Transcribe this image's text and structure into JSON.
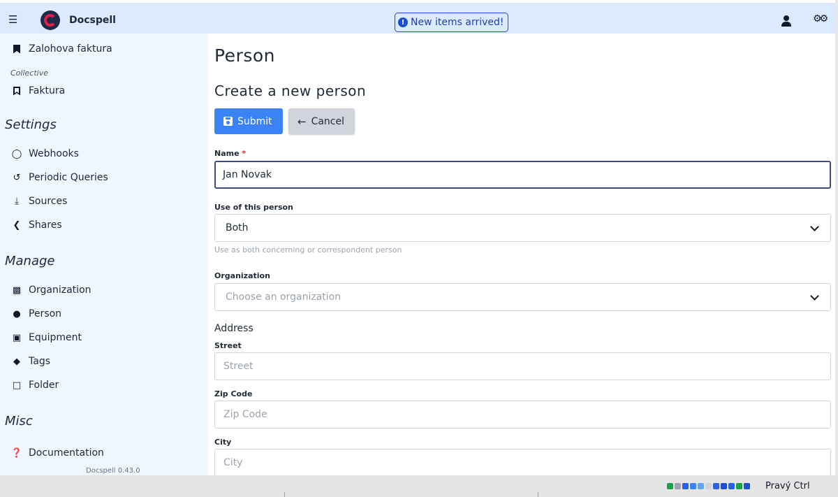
{
  "header": {
    "app_name": "Docspell",
    "banner": "New items arrived!",
    "banner_icon": "info-circle-icon",
    "brand_color": "#1e2a4a"
  },
  "sidebar": {
    "bookmarks": [
      {
        "label": "Zalohova faktura",
        "icon": "bookmark-solid-icon"
      }
    ],
    "collective_label": "Collective",
    "collective_bookmarks": [
      {
        "label": "Faktura",
        "icon": "bookmark-outline-icon"
      }
    ],
    "settings_heading": "Settings",
    "settings": [
      {
        "label": "Webhooks",
        "icon": "comment-icon"
      },
      {
        "label": "Periodic Queries",
        "icon": "history-icon"
      },
      {
        "label": "Sources",
        "icon": "upload-icon"
      },
      {
        "label": "Shares",
        "icon": "share-icon"
      }
    ],
    "manage_heading": "Manage",
    "manage": [
      {
        "label": "Organization",
        "icon": "industry-icon"
      },
      {
        "label": "Person",
        "icon": "user-icon"
      },
      {
        "label": "Equipment",
        "icon": "box-icon"
      },
      {
        "label": "Tags",
        "icon": "tags-icon"
      },
      {
        "label": "Folder",
        "icon": "folder-icon"
      }
    ],
    "misc_heading": "Misc",
    "misc": [
      {
        "label": "Documentation",
        "icon": "question-circle-icon"
      }
    ],
    "version": "Docspell 0.43.0"
  },
  "main": {
    "title": "Person",
    "subtitle": "Create a new person",
    "submit_label": "Submit",
    "cancel_label": "Cancel",
    "name_label": "Name",
    "name_required": "*",
    "name_value": "Jan Novak",
    "use_label": "Use of this person",
    "use_value": "Both",
    "use_help": "Use as both concerning or correspondent person",
    "org_label": "Organization",
    "org_placeholder": "Choose an organization",
    "address_heading": "Address",
    "street_label": "Street",
    "street_placeholder": "Street",
    "zip_label": "Zip Code",
    "zip_placeholder": "Zip Code",
    "city_label": "City",
    "city_placeholder": "City"
  },
  "statusbar": {
    "host_key": "Pravý Ctrl"
  },
  "colors": {
    "topbar": "#dbeafe",
    "sidebar": "#eff6ff",
    "primary_button": "#3b82f6",
    "secondary_button": "#d1d5db"
  }
}
